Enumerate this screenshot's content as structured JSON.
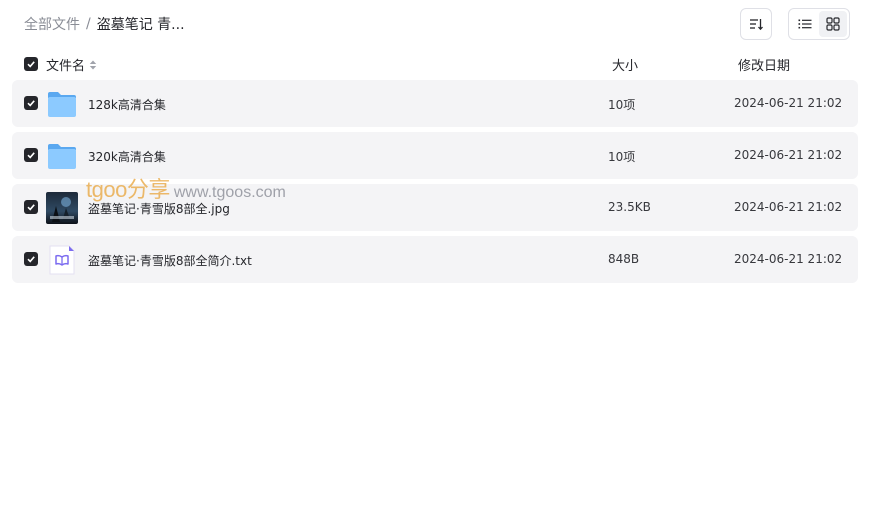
{
  "breadcrumb": {
    "root": "全部文件",
    "separator": "/",
    "current": "盗墓笔记 青..."
  },
  "toolbar": {
    "sort_icon": "sort-lines-icon",
    "list_view_icon": "list-view-icon",
    "grid_view_icon": "grid-view-icon",
    "active_view": "list"
  },
  "header": {
    "name": "文件名",
    "size": "大小",
    "date": "修改日期"
  },
  "files": [
    {
      "name": "128k高清合集",
      "size": "10项",
      "date": "2024-06-21 21:02",
      "type": "folder",
      "checked": true
    },
    {
      "name": "320k高清合集",
      "size": "10项",
      "date": "2024-06-21 21:02",
      "type": "folder",
      "checked": true
    },
    {
      "name": "盗墓笔记·青雪版8部全.jpg",
      "size": "23.5KB",
      "date": "2024-06-21 21:02",
      "type": "image",
      "checked": true
    },
    {
      "name": "盗墓笔记·青雪版8部全简介.txt",
      "size": "848B",
      "date": "2024-06-21 21:02",
      "type": "text",
      "checked": true
    }
  ],
  "watermark": {
    "brand": "tgoo分享",
    "url": "www.tgoos.com"
  },
  "colors": {
    "checkbox": "#25262b",
    "row_bg": "#f4f4f6",
    "folder": "#6fb6f5",
    "txt_icon": "#7c6cf0",
    "watermark_brand": "#e8a43a"
  }
}
